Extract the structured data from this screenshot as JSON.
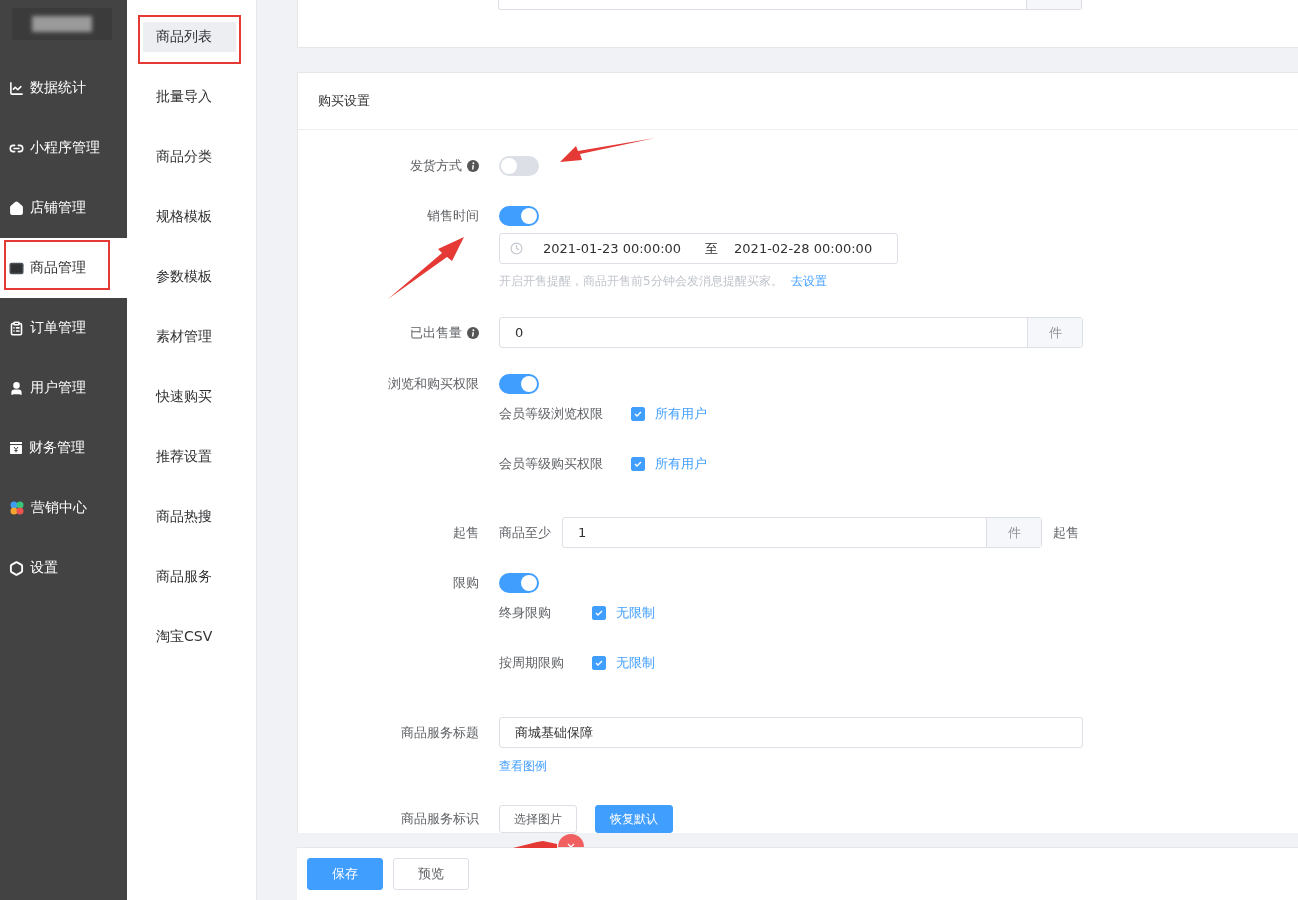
{
  "sidebar": {
    "items": [
      {
        "label": "数据统计",
        "selected": false,
        "annotated": false
      },
      {
        "label": "小程序管理",
        "selected": false,
        "annotated": false
      },
      {
        "label": "店铺管理",
        "selected": false,
        "annotated": false
      },
      {
        "label": "商品管理",
        "selected": true,
        "annotated": true
      },
      {
        "label": "订单管理",
        "selected": false,
        "annotated": false
      },
      {
        "label": "用户管理",
        "selected": false,
        "annotated": false
      },
      {
        "label": "财务管理",
        "selected": false,
        "annotated": false
      },
      {
        "label": "营销中心",
        "selected": false,
        "annotated": false
      },
      {
        "label": "设置",
        "selected": false,
        "annotated": false
      }
    ]
  },
  "subnav": {
    "items": [
      {
        "label": "商品列表",
        "selected": true,
        "annotated": true
      },
      {
        "label": "批量导入",
        "selected": false,
        "annotated": false
      },
      {
        "label": "商品分类",
        "selected": false,
        "annotated": false
      },
      {
        "label": "规格模板",
        "selected": false,
        "annotated": false
      },
      {
        "label": "参数模板",
        "selected": false,
        "annotated": false
      },
      {
        "label": "素材管理",
        "selected": false,
        "annotated": false
      },
      {
        "label": "快速购买",
        "selected": false,
        "annotated": false
      },
      {
        "label": "推荐设置",
        "selected": false,
        "annotated": false
      },
      {
        "label": "商品热搜",
        "selected": false,
        "annotated": false
      },
      {
        "label": "商品服务",
        "selected": false,
        "annotated": false
      },
      {
        "label": "淘宝CSV",
        "selected": false,
        "annotated": false
      }
    ]
  },
  "section": {
    "title": "购买设置",
    "fields": [
      {
        "kind": "switch",
        "label": "发货方式",
        "info": true,
        "on": false
      },
      {
        "kind": "switch",
        "label": "销售时间",
        "info": false,
        "on": true,
        "range": {
          "start": "2021-01-23 00:00:00",
          "separator": "至",
          "end": "2021-02-28 00:00:00"
        },
        "hint": "开启开售提醒，商品开售前5分钟会发消息提醒买家。",
        "hint_link": "去设置"
      },
      {
        "kind": "number",
        "label": "已出售量",
        "info": true,
        "value": "0",
        "unit": "件"
      },
      {
        "kind": "switch",
        "label": "浏览和购买权限",
        "info": false,
        "on": true,
        "options": [
          {
            "label": "会员等级浏览权限",
            "checked": true,
            "text": "所有用户"
          },
          {
            "label": "会员等级购买权限",
            "checked": true,
            "text": "所有用户"
          }
        ]
      },
      {
        "kind": "number",
        "label": "起售",
        "info": false,
        "prefix": "商品至少",
        "value": "1",
        "unit": "件",
        "suffix": "起售"
      },
      {
        "kind": "switch",
        "label": "限购",
        "info": false,
        "on": true,
        "options": [
          {
            "label": "终身限购",
            "checked": true,
            "text": "无限制"
          },
          {
            "label": "按周期限购",
            "checked": true,
            "text": "无限制"
          }
        ]
      },
      {
        "kind": "text",
        "label": "商品服务标题",
        "info": false,
        "value": "商城基础保障",
        "link": "查看图例"
      },
      {
        "kind": "buttons",
        "label": "商品服务标识",
        "info": false,
        "buttons": [
          {
            "label": "选择图片",
            "primary": false
          },
          {
            "label": "恢复默认",
            "primary": true
          }
        ]
      }
    ]
  },
  "footer": {
    "buttons": [
      {
        "label": "保存",
        "primary": true
      },
      {
        "label": "预览",
        "primary": false
      }
    ]
  }
}
